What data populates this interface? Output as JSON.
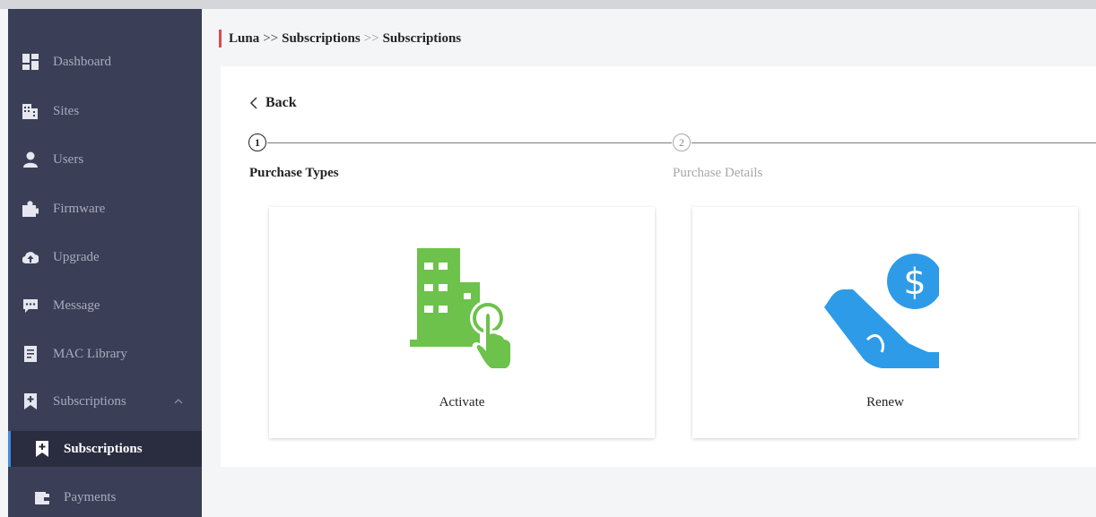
{
  "sidebar": {
    "items": [
      {
        "label": "Dashboard"
      },
      {
        "label": "Sites"
      },
      {
        "label": "Users"
      },
      {
        "label": "Firmware"
      },
      {
        "label": "Upgrade"
      },
      {
        "label": "Message"
      },
      {
        "label": "MAC Library"
      },
      {
        "label": "Subscriptions",
        "expanded": true
      },
      {
        "label": "Subscriptions",
        "active": true
      },
      {
        "label": "Payments"
      }
    ]
  },
  "breadcrumb": {
    "root": "Luna",
    "sep1": ">>",
    "parent": "Subscriptions",
    "sep2": ">>",
    "current": "Subscriptions"
  },
  "back_label": "Back",
  "steps": [
    {
      "number": "1",
      "label": "Purchase Types",
      "active": true
    },
    {
      "number": "2",
      "label": "Purchase Details",
      "active": false
    }
  ],
  "cards": [
    {
      "label": "Activate",
      "icon": "building-tap-icon"
    },
    {
      "label": "Renew",
      "icon": "hand-dollar-icon"
    }
  ],
  "colors": {
    "sidebar_bg": "#3b3e57",
    "sidebar_active_bg": "#2a2c40",
    "accent_bar": "#e0474f",
    "active_indicator": "#3f8de0",
    "activate_green": "#6cc24a",
    "renew_blue": "#2e9be8"
  }
}
